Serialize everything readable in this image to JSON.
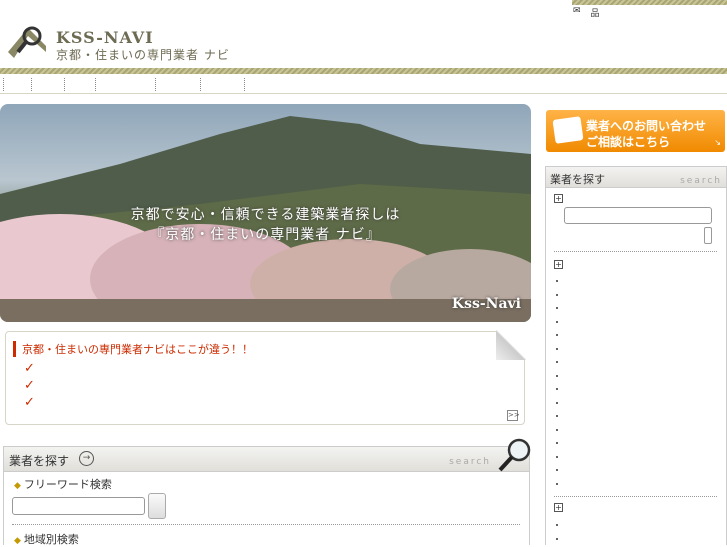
{
  "header": {
    "brand": "KSS-NAVI",
    "tagline": "京都・住まいの専門業者 ナビ",
    "top_icons": [
      "mail-icon",
      "sitemap-icon"
    ]
  },
  "hero": {
    "line1": "京都で安心・信頼できる建築業者探しは",
    "line2": "『京都・住まいの専門業者 ナビ』",
    "watermark": "Kss-Navi"
  },
  "feature": {
    "title": "京都・住まいの専門業者ナビはここが違う！！",
    "more_label": ">>"
  },
  "search": {
    "heading": "業者を探す",
    "search_word": "search",
    "free_word": "フリーワード検索",
    "area": "地域別検索"
  },
  "contact": {
    "line1": "業者へのお問い合わせ",
    "line2": "ご相談はこちら"
  },
  "sidebar": {
    "heading": "業者を探す",
    "search_word": "search",
    "expand_symbol": "+"
  },
  "colors": {
    "accent": "#cc2b00",
    "brand": "#6d6b52",
    "contact": "#f08a00"
  }
}
